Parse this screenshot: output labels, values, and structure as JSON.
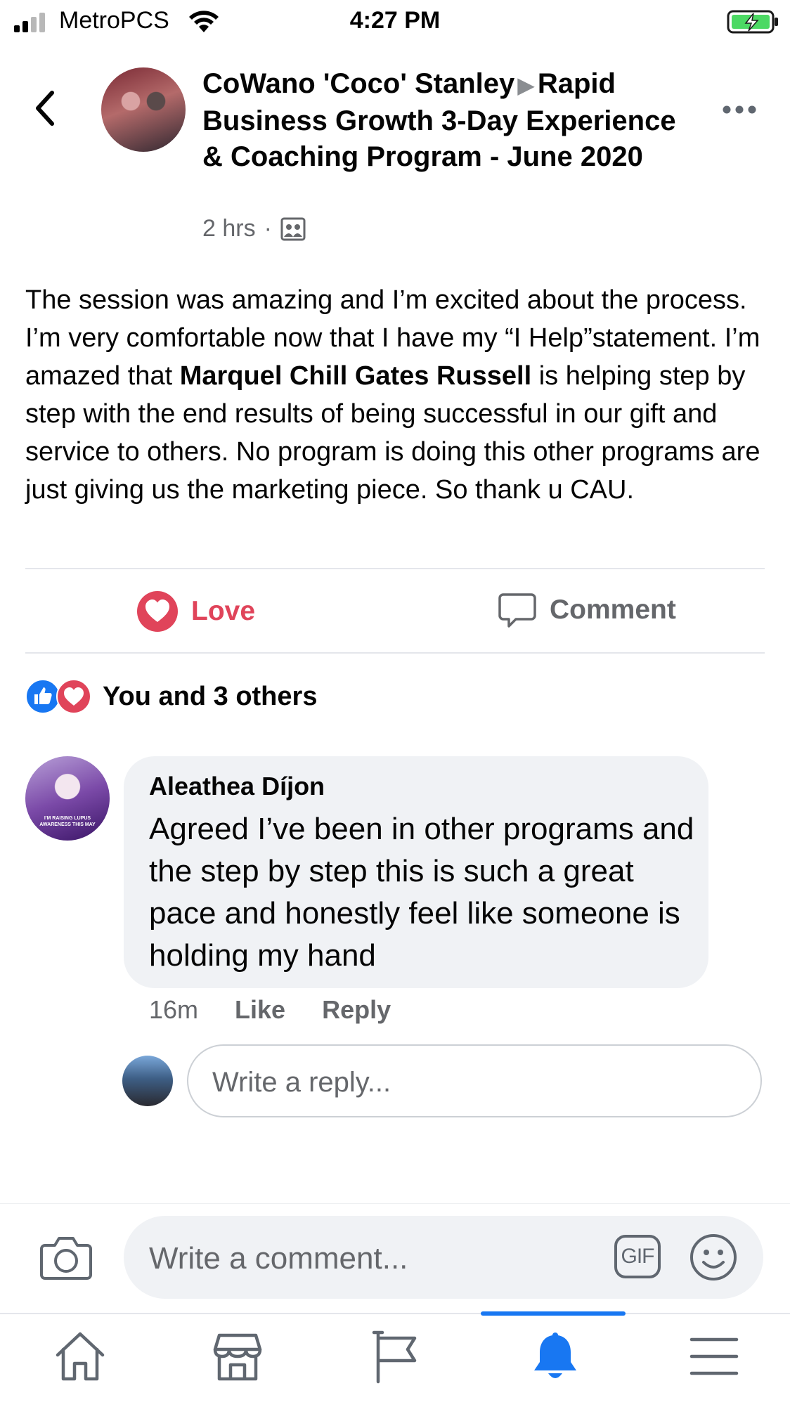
{
  "status_bar": {
    "carrier": "MetroPCS",
    "time": "4:27 PM"
  },
  "post": {
    "author": "CoWano 'Coco' Stanley",
    "group": "Rapid Business Growth 3-Day Experience & Coaching Program - June 2020",
    "time": "2 hrs",
    "body_part1": "The session was amazing and I’m excited about the process. I’m very comfortable now that I have my “I Help”statement. I’m amazed that ",
    "body_mention": "Marquel Chill Gates Russell",
    "body_part2": " is helping step by step with the end results of being successful in our gift and service to others. No program is doing this other programs are just giving us the marketing piece. So thank u CAU."
  },
  "actions": {
    "love_label": "Love",
    "comment_label": "Comment"
  },
  "reactions_summary": "You and 3 others",
  "comments": [
    {
      "author": "Aleathea Díjon",
      "text": "Agreed I’ve been in other programs and the step by step this is such a great pace and honestly feel like someone is holding my hand",
      "time": "16m",
      "like_label": "Like",
      "reply_label": "Reply",
      "avatar_caption": "I'M RAISING LUPUS AWARENESS THIS MAY"
    }
  ],
  "reply_input": {
    "placeholder": "Write a reply..."
  },
  "composer": {
    "placeholder": "Write a comment...",
    "gif_label": "GIF"
  },
  "tabbar": {
    "items": [
      "home-icon",
      "marketplace-icon",
      "pages-flag-icon",
      "notifications-bell-icon",
      "menu-icon"
    ],
    "active_index": 3
  },
  "colors": {
    "love": "#e0445a",
    "like_blue": "#1877f2",
    "secondary_text": "#65676b"
  }
}
